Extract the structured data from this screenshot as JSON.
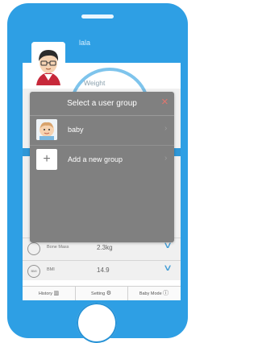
{
  "app": {
    "user_name": "lala",
    "weight_label": "Weight"
  },
  "metrics": [
    {
      "icon": "bone-icon",
      "icon_text": "",
      "label": "Bone Mass",
      "value": "2.3kg"
    },
    {
      "icon": "bmi-icon",
      "icon_text": "BMI",
      "label": "BMI",
      "value": "14.9"
    }
  ],
  "tabs": [
    {
      "label": "History",
      "icon": "chart-icon"
    },
    {
      "label": "Setting",
      "icon": "gear-icon"
    },
    {
      "label": "Baby Mode",
      "icon": "info-icon"
    }
  ],
  "dialog": {
    "title": "Select a user group",
    "close_glyph": "×",
    "items": [
      {
        "label": "baby",
        "icon": "baby-avatar-icon"
      },
      {
        "label": "Add a new group",
        "icon": "plus-icon",
        "glyph": "+"
      }
    ]
  },
  "colors": {
    "phone_blue": "#2e9fe4",
    "dialog_gray": "#808080",
    "close_red": "#e0756e",
    "chevron_blue": "#47a7e3"
  }
}
